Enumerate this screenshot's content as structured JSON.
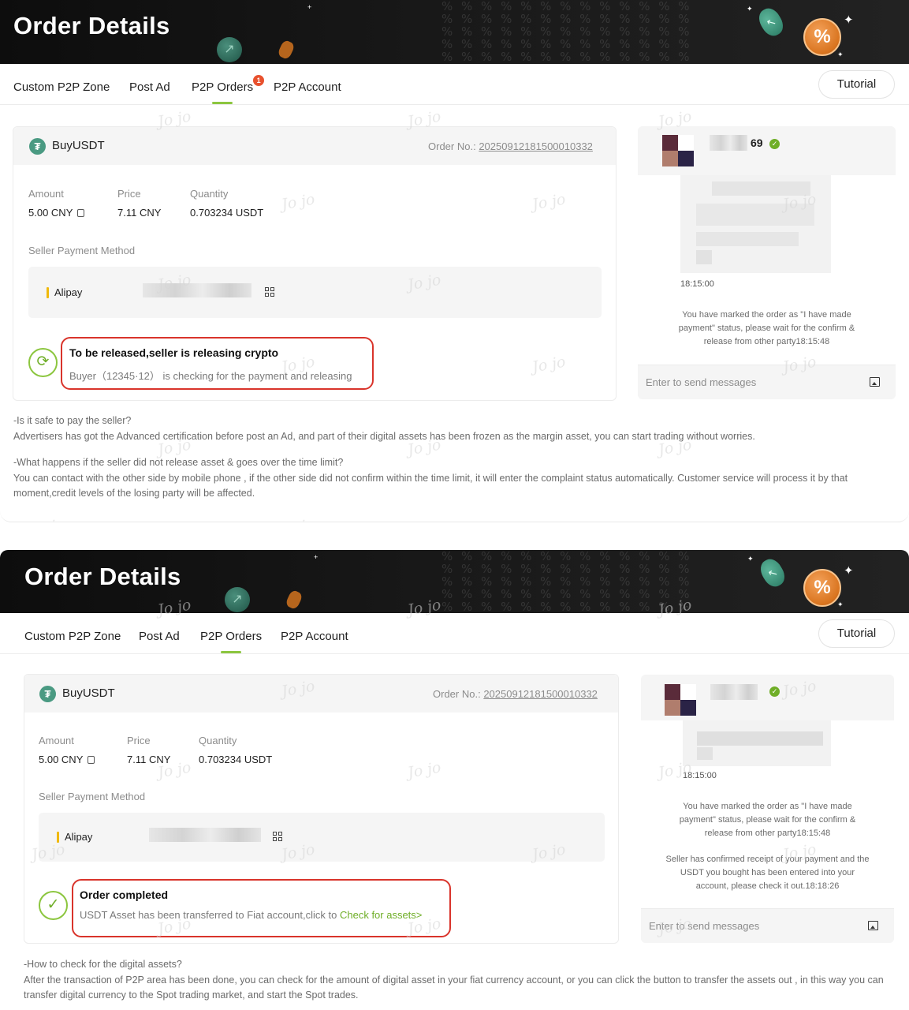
{
  "page": {
    "title": "Order Details",
    "nav": {
      "tabs": [
        "Custom P2P Zone",
        "Post Ad",
        "P2P Orders",
        "P2P Account"
      ],
      "active_tab": "P2P Orders",
      "badge": "1",
      "tutorial_label": "Tutorial"
    },
    "order": {
      "side_asset": "BuyUSDT",
      "order_no_label": "Order No.:",
      "order_no": "20250912181500010332",
      "amount_label": "Amount",
      "amount": "5.00 CNY",
      "price_label": "Price",
      "price": "7.11 CNY",
      "quantity_label": "Quantity",
      "quantity": "0.703234 USDT",
      "payment_method_label": "Seller Payment Method",
      "payment_method": "Alipay"
    },
    "chat": {
      "username_suffix": "69",
      "time": "18:15:00",
      "msg_payment": "You have marked the order as \"I have made payment\" status, please wait for the confirm & release from other party18:15:48",
      "msg_confirmed": "Seller has confirmed receipt of your payment and the USDT you bought has been entered into your account, please check it out.18:18:26",
      "input_placeholder": "Enter to send messages"
    },
    "watermark": "Jo jo"
  },
  "screen_1": {
    "status_title": "To be released,seller is releasing crypto",
    "status_desc": "Buyer（12345·12） is checking for the payment and releasing",
    "faq": [
      "-Is it safe to pay the seller?",
      "Advertisers has got the Advanced certification before post an Ad, and part of their digital assets has been frozen as the margin asset, you can start trading without worries.",
      "-What happens if the seller did not release asset & goes over the time limit?",
      "You can contact with the other side by mobile phone , if the other side did not confirm within the time limit, it will enter the complaint status automatically. Customer service will process it by that moment,credit levels of the losing party will be affected."
    ]
  },
  "screen_2": {
    "status_title": "Order completed",
    "status_desc": "USDT Asset has been transferred to Fiat account,click to ",
    "status_link": "Check for assets>",
    "faq": [
      "-How to check for the digital assets?",
      "After the transaction of P2P area has been done, you can check for the amount of digital asset in your fiat currency account, or you can click the button to transfer the assets out , in this way you can transfer digital currency to the Spot trading market, and start the Spot trades."
    ]
  },
  "colors": {
    "accent_green": "#8cc63f",
    "highlight_red": "#d9342b",
    "banner_dark": "#111111",
    "badge_red": "#e8512e"
  }
}
